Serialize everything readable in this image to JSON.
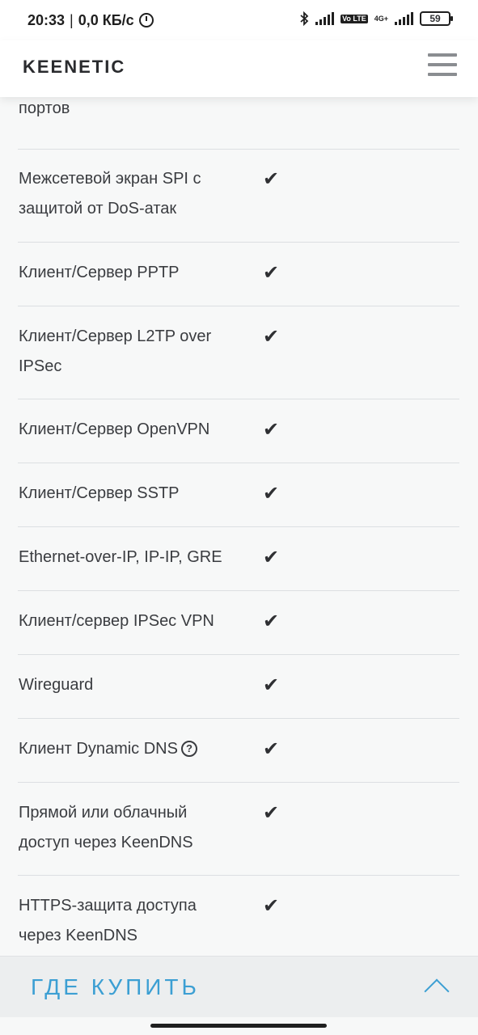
{
  "status": {
    "time": "20:33",
    "separator": "|",
    "speed": "0,0 КБ/с",
    "battery": "59",
    "volte": "Vo LTE",
    "network": "4G+"
  },
  "header": {
    "logo": "KEENETIC"
  },
  "features": {
    "check": "✔",
    "rows": [
      {
        "name": "портов",
        "supported": ""
      },
      {
        "name": "Межсетевой экран SPI с защитой от DoS-атак",
        "supported": "✔"
      },
      {
        "name": "Клиент/Сервер PPTP",
        "supported": "✔"
      },
      {
        "name": "Клиент/Сервер L2TP over IPSec",
        "supported": "✔"
      },
      {
        "name": "Клиент/Сервер OpenVPN",
        "supported": "✔"
      },
      {
        "name": "Клиент/Сервер SSTP",
        "supported": "✔"
      },
      {
        "name": "Ethernet-over-IP, IP-IP, GRE",
        "supported": "✔"
      },
      {
        "name": "Клиент/сервер IPSec VPN",
        "supported": "✔"
      },
      {
        "name": "Wireguard",
        "supported": "✔"
      },
      {
        "name": "Клиент Dynamic DNS",
        "supported": "✔",
        "help": "?"
      },
      {
        "name": "Прямой или облачный доступ через KeenDNS",
        "supported": "✔"
      },
      {
        "name": "HTTPS-защита доступа через KeenDNS",
        "supported": "✔"
      }
    ]
  },
  "buy_bar": {
    "label": "ГДЕ КУПИТЬ"
  }
}
